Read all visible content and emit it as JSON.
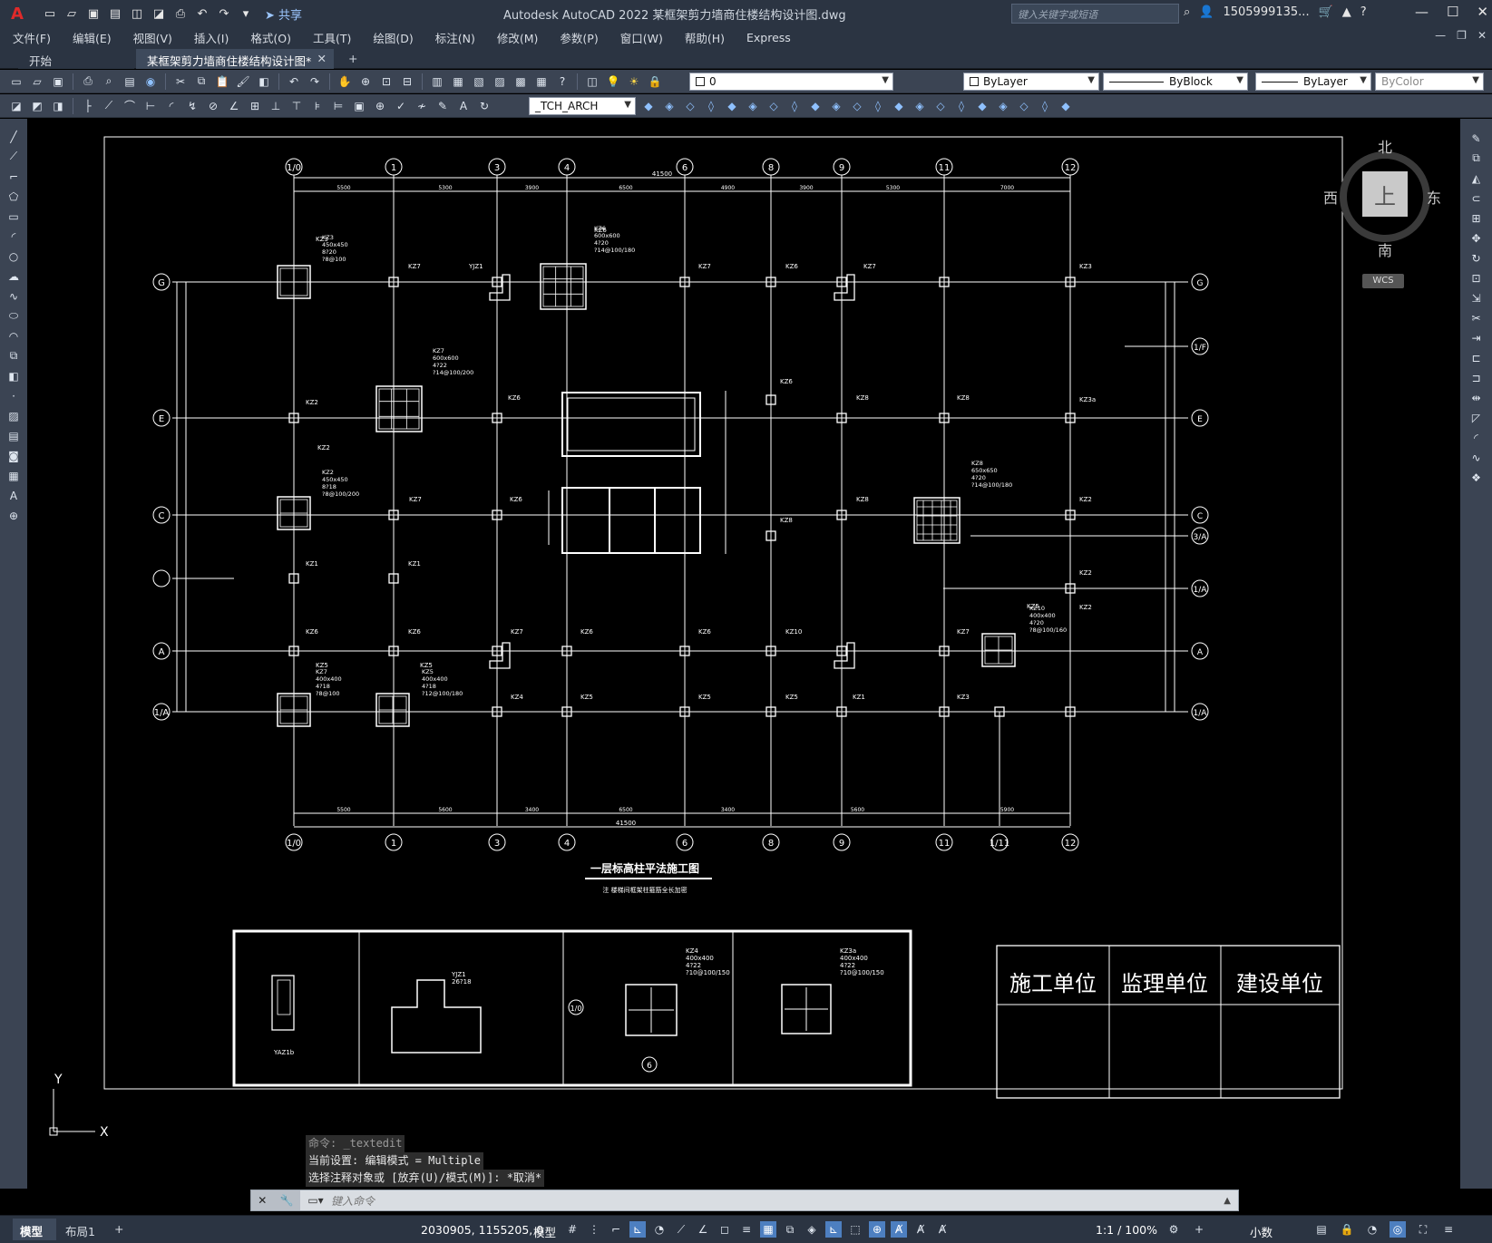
{
  "app": {
    "logo": "A",
    "title": "Autodesk AutoCAD 2022    某框架剪力墙商住楼结构设计图.dwg",
    "share_label": "共享",
    "search_placeholder": "键入关键字或短语",
    "user": "1505999135...",
    "help": "?"
  },
  "menu": [
    "文件(F)",
    "编辑(E)",
    "视图(V)",
    "插入(I)",
    "格式(O)",
    "工具(T)",
    "绘图(D)",
    "标注(N)",
    "修改(M)",
    "参数(P)",
    "窗口(W)",
    "帮助(H)",
    "Express"
  ],
  "tabs": {
    "start": "开始",
    "drawing": "某框架剪力墙商住楼结构设计图*",
    "close": "✕",
    "add": "+"
  },
  "toolbar1": {
    "layer_value": "0",
    "color_value": "ByLayer",
    "linetype_value": "ByBlock",
    "lineweight_value": "ByLayer",
    "plotstyle_value": "ByColor"
  },
  "toolbar2": {
    "textstyle_value": "_TCH_ARCH"
  },
  "viewcube": {
    "north": "北",
    "south": "南",
    "east": "东",
    "west": "西",
    "face": "上",
    "wcs": "WCS"
  },
  "drawing": {
    "title": "一层标高柱平法施工图",
    "note": "注 楼梯间框架柱箍筋全长加密",
    "axes_top": [
      "1/0",
      "1",
      "3",
      "4",
      "6",
      "8",
      "9",
      "11",
      "12"
    ],
    "axes_bottom": [
      "1/0",
      "1",
      "3",
      "4",
      "6",
      "8",
      "9",
      "11",
      "1/11",
      "12"
    ],
    "axes_left": [
      "G",
      "E",
      "C",
      "",
      "A",
      "1/A"
    ],
    "axes_right": [
      "G",
      "1/F",
      "E",
      "C",
      "3/A",
      "1/A",
      "A",
      "1/A"
    ],
    "dim_total": "41500",
    "dims_top": [
      "5500",
      "5300",
      "3900",
      "6500",
      "4900",
      "3900",
      "5300",
      "7000"
    ],
    "dims_bottom": [
      "5500",
      "5600",
      "3400",
      "6500",
      "3400",
      "5600",
      "5900"
    ],
    "col_labels": [
      "KZ3",
      "KZ7",
      "YJZ1",
      "KZ6",
      "KZ7",
      "KZ6",
      "KZ7",
      "KZ3",
      "KZ2",
      "KZ6",
      "KZ6",
      "KZ8",
      "KZ8",
      "KZ3a",
      "KZ2",
      "KZ7",
      "KZ6",
      "KZ8",
      "KZ8",
      "KZ2",
      "KZ1",
      "KZ1",
      "KZ2",
      "KZ2",
      "KZ6",
      "KZ6",
      "KZ7",
      "KZ6",
      "KZ6",
      "KZ10",
      "KZ7",
      "KZ5",
      "KZ5",
      "KZ5",
      "KZ4",
      "KZ5",
      "KZ5",
      "KZ5",
      "KZ1",
      "KZ3"
    ],
    "detail_labels": [
      "KZ3",
      "450x450",
      "8?20",
      "?8@100",
      "KZ6",
      "600x600",
      "4?20",
      "?14@100/180",
      "KZ7",
      "600x600",
      "4?22",
      "?14@100/200",
      "KZ2",
      "450x450",
      "8?18",
      "?8@100/200",
      "KZ8",
      "650x650",
      "4?20",
      "?14@100/180",
      "KZ10",
      "400x400",
      "4?20",
      "?8@100/160",
      "KZ7",
      "400x400",
      "4?18",
      "?8@100",
      "KZ5",
      "400x400",
      "4?18",
      "?12@100/180"
    ],
    "legend": {
      "kz4": [
        "KZ4",
        "400x400",
        "4?22",
        "?10@100/150"
      ],
      "kz3a": [
        "KZ3a",
        "400x400",
        "4?22",
        "?10@100/150"
      ],
      "yjz": [
        "YJZ1",
        "26?18"
      ]
    },
    "signatures": [
      "施工单位",
      "监理单位",
      "建设单位"
    ],
    "ucs_y": "Y",
    "ucs_x": "X"
  },
  "command": {
    "history": [
      "命令: _textedit",
      "当前设置: 编辑模式 = Multiple",
      "选择注释对象或 [放弃(U)/模式(M)]: *取消*"
    ],
    "placeholder": "键入命令"
  },
  "status": {
    "model_tab": "模型",
    "layout_tab": "布局1",
    "add": "+",
    "coords": "2030905, 1155205, 0",
    "space": "模型",
    "scale": "1:1 / 100%",
    "units": "小数"
  }
}
